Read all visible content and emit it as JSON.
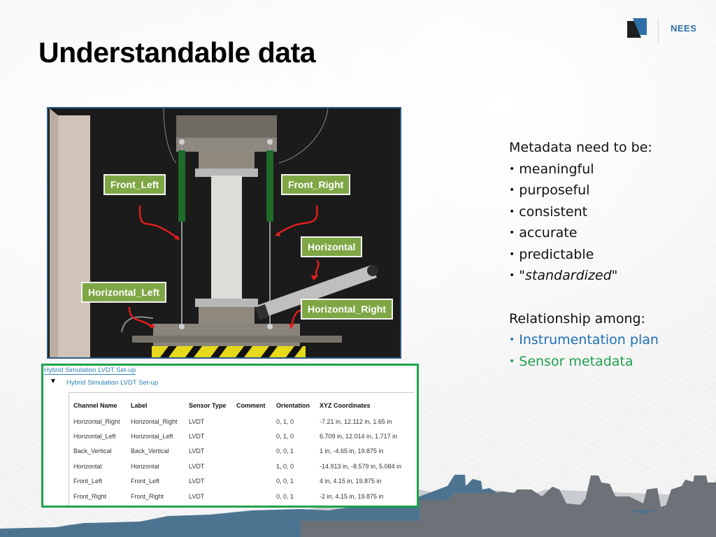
{
  "logo": {
    "text": "NEES",
    "icon": "nees-logo-icon"
  },
  "title": "Understandable data",
  "photo": {
    "labels": {
      "front_left": "Front_Left",
      "front_right": "Front_Right",
      "horizontal": "Horizontal",
      "horizontal_left": "Horizontal_Left",
      "horizontal_right": "Horizontal_Right"
    },
    "colors": {
      "label_bg": "#7fa745",
      "arrow": "#e01e1e",
      "frame": "#2f5b86"
    }
  },
  "metadata_list": {
    "heading": "Metadata  need to be:",
    "items": [
      "meaningful",
      "purposeful",
      "consistent",
      "accurate",
      "predictable"
    ],
    "last_item": {
      "open_quote": "\"",
      "text": "standardized",
      "close_quote": "\""
    }
  },
  "relationship": {
    "heading": "Relationship among:",
    "items": [
      {
        "text": "Instrumentation plan",
        "color": "#1f6fb5"
      },
      {
        "text": "Sensor metadata",
        "color": "#1fa050"
      }
    ]
  },
  "sensor_panel": {
    "top_link": "Hybrid Simulation LVDT Set-up",
    "tree_toggle": "▼",
    "tree_link": "Hybrid Simulation LVDT Set-up",
    "columns": [
      "Channel Name",
      "Label",
      "Sensor Type",
      "Comment",
      "Orientation",
      "XYZ Coordinates"
    ],
    "rows": [
      [
        "Horizontal_Right",
        "Horizontal_Right",
        "LVDT",
        "",
        "0, 1, 0",
        "-7.21 in, 12.112 in, 1.65 in"
      ],
      [
        "Horizontal_Left",
        "Horizontal_Left",
        "LVDT",
        "",
        "0, 1, 0",
        "6.709 in, 12.014 in, 1.717 in"
      ],
      [
        "Back_Vertical",
        "Back_Vertical",
        "LVDT",
        "",
        "0, 0, 1",
        "1 in, -4.65 in, 19.875 in"
      ],
      [
        "Horizontal",
        "Horizontal",
        "LVDT",
        "",
        "1, 0, 0",
        "-14.913 in, -8.579 in, 5.084 in"
      ],
      [
        "Front_Left",
        "Front_Left",
        "LVDT",
        "",
        "0, 0, 1",
        "4 in, 4.15 in, 19.875 in"
      ],
      [
        "Front_Right",
        "Front_Right",
        "LVDT",
        "",
        "0, 0, 1",
        "-2 in, 4.15 in, 19.875 in"
      ]
    ],
    "border_color": "#1ea24c"
  }
}
